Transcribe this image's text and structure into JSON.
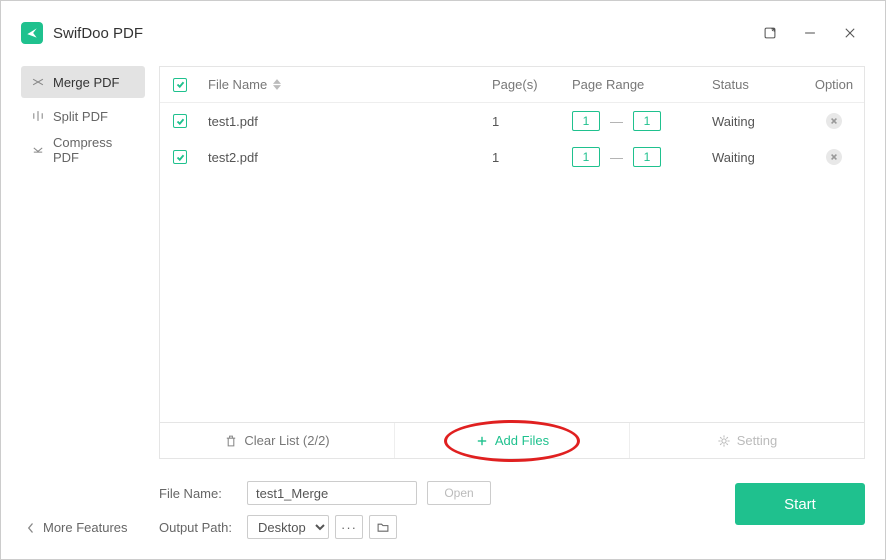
{
  "app": {
    "title": "SwifDoo PDF"
  },
  "sidebar": {
    "items": [
      {
        "label": "Merge PDF"
      },
      {
        "label": "Split PDF"
      },
      {
        "label": "Compress PDF"
      }
    ],
    "more_label": "More Features"
  },
  "table": {
    "headers": {
      "filename": "File Name",
      "pages": "Page(s)",
      "range": "Page Range",
      "status": "Status",
      "option": "Option"
    },
    "rows": [
      {
        "name": "test1.pdf",
        "pages": "1",
        "from": "1",
        "to": "1",
        "status": "Waiting"
      },
      {
        "name": "test2.pdf",
        "pages": "1",
        "from": "1",
        "to": "1",
        "status": "Waiting"
      }
    ]
  },
  "actions": {
    "clear": "Clear List (2/2)",
    "add": "Add Files",
    "setting": "Setting"
  },
  "footer": {
    "filename_label": "File Name:",
    "filename_value": "test1_Merge",
    "open_label": "Open",
    "output_label": "Output Path:",
    "output_value": "Desktop",
    "start_label": "Start"
  }
}
